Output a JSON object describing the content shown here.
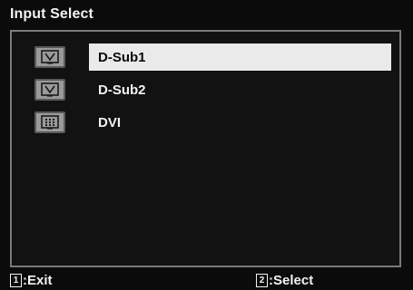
{
  "osd": {
    "title": "Input Select",
    "items": [
      {
        "label": "D-Sub1",
        "icon": "monitor-dsub-icon",
        "selected": true
      },
      {
        "label": "D-Sub2",
        "icon": "monitor-dsub-icon",
        "selected": false
      },
      {
        "label": "DVI",
        "icon": "monitor-dvi-icon",
        "selected": false
      }
    ],
    "footer": {
      "exit_key": "1",
      "exit_label": ":Exit",
      "select_key": "2",
      "select_label": ":Select"
    }
  },
  "colors": {
    "background": "#0b0b0b",
    "panel_border": "#7a7a7a",
    "highlight": "#eaeaea",
    "text": "#f2f2f2",
    "icon_fill": "#9a9a9a"
  }
}
